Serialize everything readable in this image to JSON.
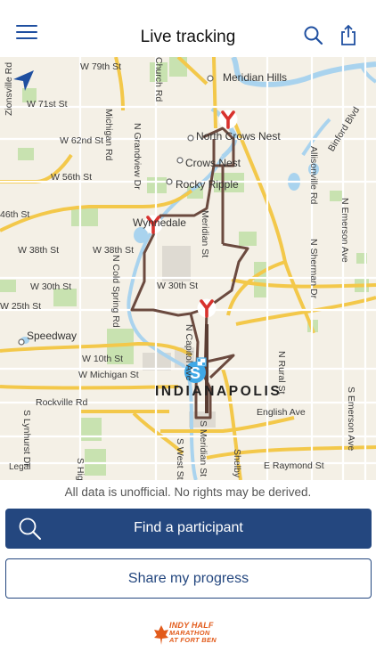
{
  "header": {
    "title": "Live tracking",
    "menu_icon": "hamburger-menu-icon",
    "search_icon": "search-icon",
    "share_icon": "share-icon"
  },
  "map": {
    "locate_icon": "location-arrow-icon",
    "streets": {
      "w79": "W 79th St",
      "w71": "W 71st St",
      "w62": "W 62nd St",
      "w56": "W 56th St",
      "w46": "46th St",
      "w38a": "W 38th St",
      "w38b": "W 38th St",
      "w30a": "W 30th St",
      "w30b": "W 30th St",
      "w25": "W 25th St",
      "w10": "W 10th St",
      "wmich": "W Michigan St",
      "rockville": "Rockville Rd",
      "english": "English Ave",
      "eraymond": "E Raymond St",
      "zionsville": "Zionsville Rd",
      "michigan": "Michigan Rd",
      "grandview": "N Grandview Dr",
      "colspring": "N Cold Spring Rd",
      "meridian": "Meridian St",
      "smeridian": "S Meridian St",
      "capitol": "N Capitol Ave",
      "nsherman": "N Sherman Dr",
      "nemerson": "N Emerson Ave",
      "semerson": "S Emerson Ave",
      "allisonville": "Allisonville Rd",
      "binford": "Binford Blvd",
      "nrural": "N Rural St",
      "slynhurst": "S Lynhurst Dr",
      "shigh": "S High",
      "swest": "S West St",
      "shelby": "Shelby",
      "church": "Church Rd"
    },
    "places": {
      "meridian_hills": "Meridian Hills",
      "north_crows_nest": "North Crows Nest",
      "crows_nest": "Crows Nest",
      "rocky_ripple": "Rocky Ripple",
      "wynnedale": "Wynnedale",
      "speedway": "Speedway",
      "indianapolis": "INDIANAPOLIS"
    },
    "legal": "Legal",
    "colors": {
      "route": "#6b4a3f",
      "marker": "#d8322e",
      "water": "#a9d3ee",
      "park": "#c8e2b0",
      "highway": "#f3c84a",
      "start_marker": "#3fa8e6"
    }
  },
  "disclaimer": "All data is unofficial. No rights may be derived.",
  "find_button": {
    "label": "Find a participant",
    "icon": "search-icon"
  },
  "share_button": {
    "label": "Share my progress"
  },
  "logo": {
    "line1": "INDY HALF",
    "line2": "MARATHON",
    "line3": "AT FORT BEN"
  }
}
